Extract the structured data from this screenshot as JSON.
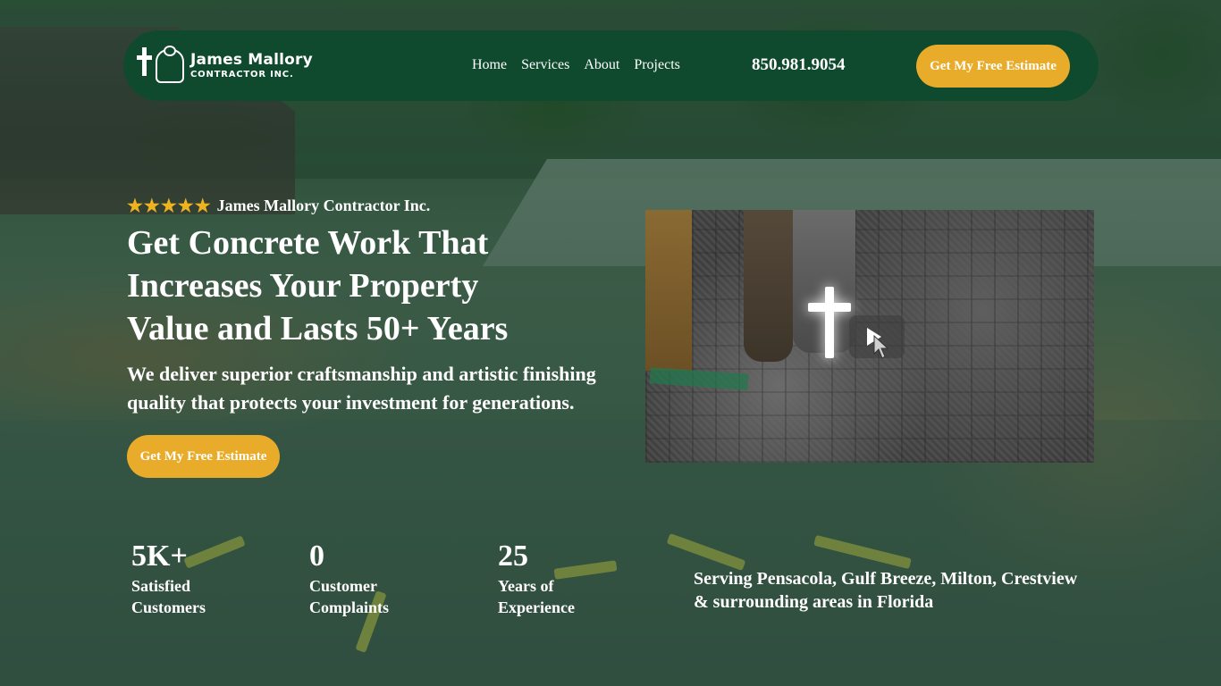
{
  "brand": {
    "name": "James Mallory",
    "subtitle": "CONTRACTOR INC."
  },
  "nav": {
    "links": [
      "Home",
      "Services",
      "About",
      "Projects"
    ],
    "phone": "850.981.9054",
    "cta_label": "Get My Free Estimate"
  },
  "hero": {
    "stars": "★★★★★",
    "rating": 5,
    "company": "James Mallory Contractor Inc.",
    "headline_lines": [
      "Get Concrete Work That",
      "Increases Your Property",
      "Value and Lasts 50+ Years"
    ],
    "subhead_lines": [
      "We deliver superior craftsmanship and artistic finishing",
      "quality that protects your investment for generations."
    ],
    "cta_label": "Get My Free Estimate"
  },
  "video": {
    "play_icon": "play-icon"
  },
  "stats": [
    {
      "value": "5K+",
      "label_lines": [
        "Satisfied",
        "Customers"
      ]
    },
    {
      "value": "0",
      "label_lines": [
        "Customer",
        "Complaints"
      ]
    },
    {
      "value": "25",
      "label_lines": [
        "Years of",
        "Experience"
      ]
    }
  ],
  "service_area": {
    "lines": [
      "Serving Pensacola, Gulf Breeze, Milton, Crestview",
      "& surrounding areas in Florida"
    ]
  },
  "colors": {
    "nav_bg": "#104a2e",
    "accent_gold": "#e9ac2a",
    "star": "#efb31f",
    "text": "#ffffff"
  }
}
